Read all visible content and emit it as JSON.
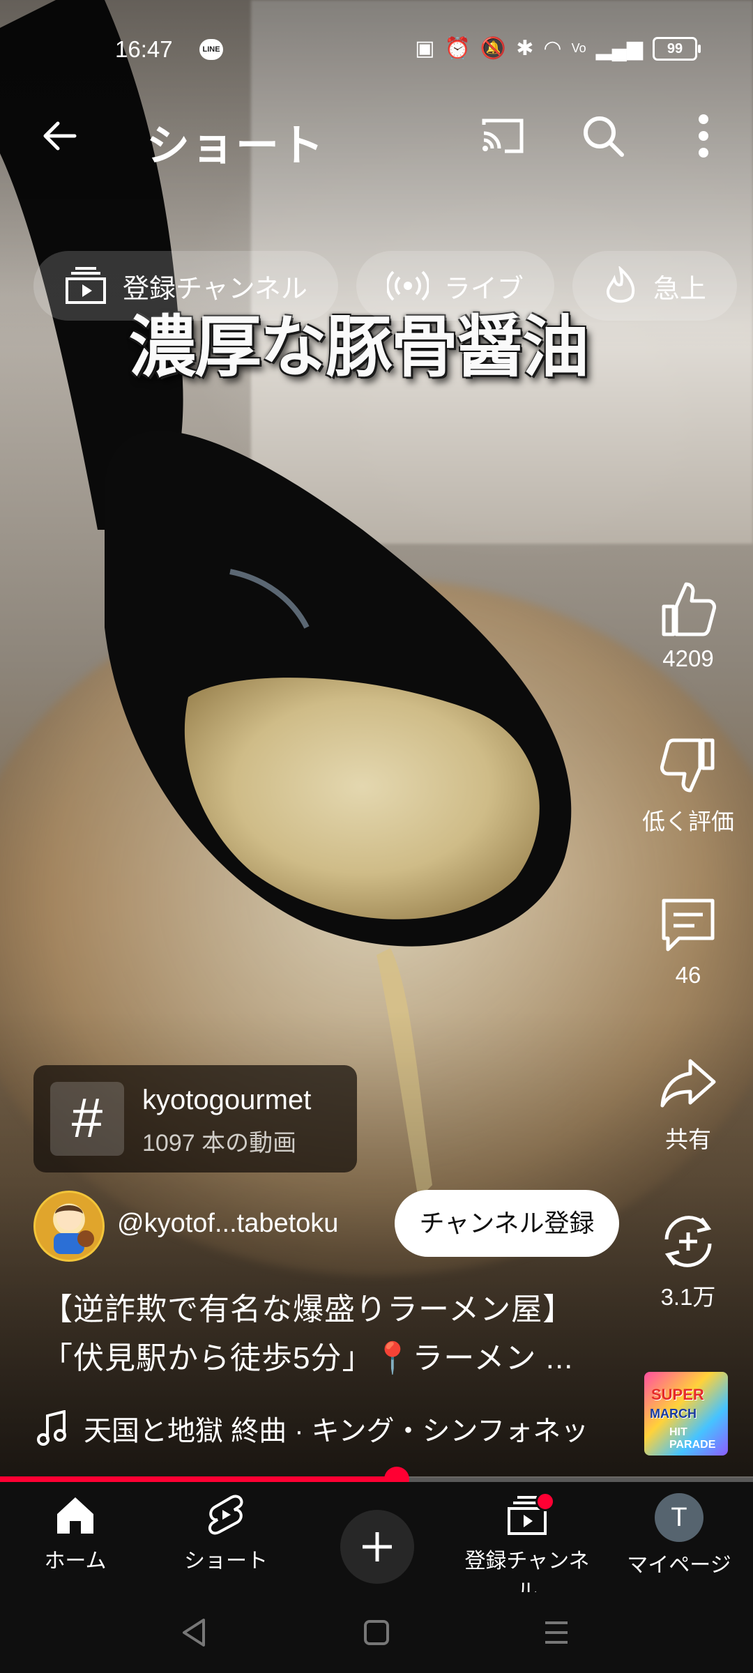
{
  "status_bar": {
    "time": "16:47",
    "line_badge": "LINE",
    "battery": "99"
  },
  "header": {
    "title": "ショート"
  },
  "chips": [
    {
      "label": "登録チャンネル",
      "icon": "subscriptions-icon"
    },
    {
      "label": "ライブ",
      "icon": "live-icon"
    },
    {
      "label": "急上",
      "icon": "trending-icon"
    }
  ],
  "video": {
    "caption": "濃厚な豚骨醤油"
  },
  "actions": {
    "like_count": "4209",
    "dislike_label": "低く評価",
    "comment_count": "46",
    "share_label": "共有",
    "remix_count": "3.1万"
  },
  "hashtag_card": {
    "icon": "#",
    "name": "kyotogourmet",
    "count": "1097 本の動画"
  },
  "channel": {
    "handle": "@kyotof...tabetoku",
    "subscribe_label": "チャンネル登録"
  },
  "title": {
    "line1": "【逆詐欺で有名な爆盛りラーメン屋】",
    "line2": "「伏見駅から徒歩5分」📍ラーメン ..."
  },
  "music": {
    "text": "天国と地獄 終曲 · キング・シンフォネッ",
    "album_line1": "SUPER",
    "album_line2": "MARCH",
    "album_line3": "HIT PARADE"
  },
  "progress": {
    "fraction": 0.527
  },
  "nav": {
    "home": "ホーム",
    "shorts": "ショート",
    "subscriptions": "登録チャンネル",
    "mypage": "マイページ",
    "avatar_letter": "T"
  },
  "colors": {
    "accent": "#ff0033",
    "nav_bg": "#0f0f0f"
  }
}
